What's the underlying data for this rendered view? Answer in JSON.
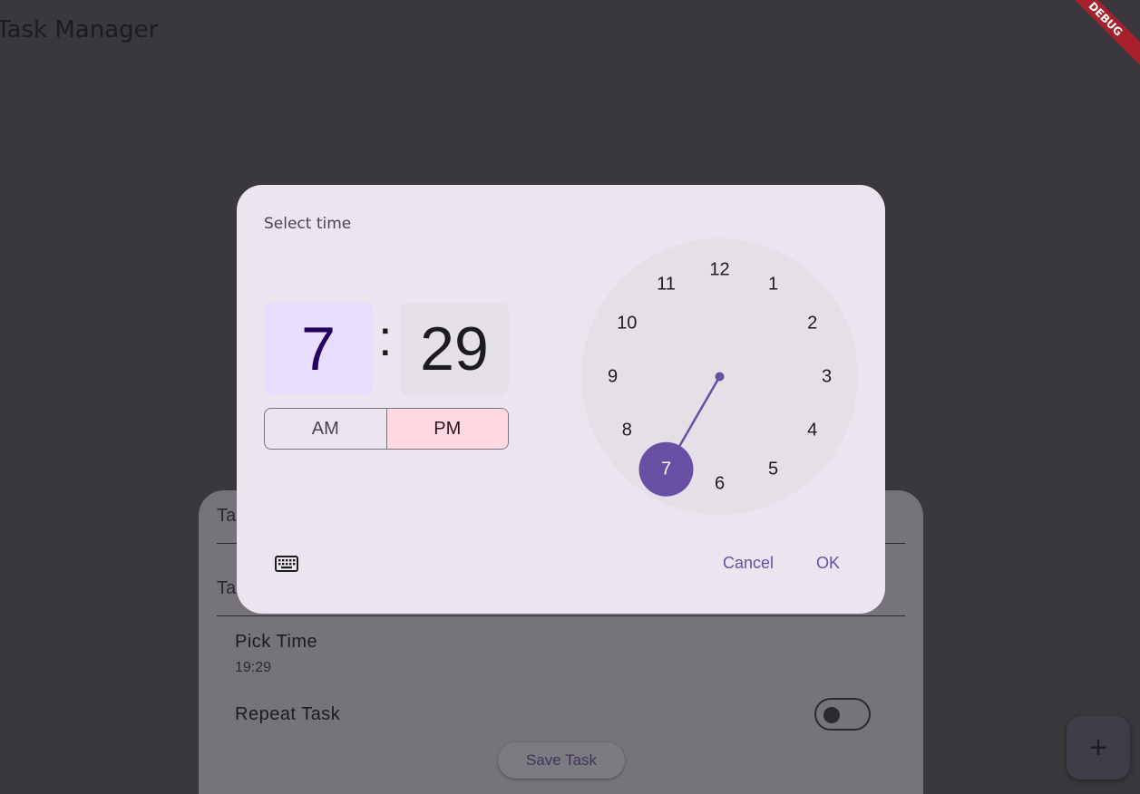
{
  "app": {
    "title": "Task Manager",
    "debug_banner": "DEBUG"
  },
  "sheet": {
    "field1_label": "Ta",
    "field2_label": "Ta",
    "pick_time_title": "Pick Time",
    "pick_time_value": "19:29",
    "repeat_title": "Repeat Task",
    "repeat_enabled": false,
    "save_label": "Save Task"
  },
  "fab": {
    "label": "+",
    "icon": "add-icon"
  },
  "dialog": {
    "title": "Select time",
    "hour": "7",
    "colon": ":",
    "minute": "29",
    "am_label": "AM",
    "pm_label": "PM",
    "period_selected": "PM",
    "cancel_label": "Cancel",
    "ok_label": "OK",
    "keyboard_icon": "keyboard-icon",
    "clock": {
      "numbers": [
        "12",
        "1",
        "2",
        "3",
        "4",
        "5",
        "6",
        "7",
        "8",
        "9",
        "10",
        "11"
      ],
      "selected": "7"
    }
  },
  "colors": {
    "accent": "#6750a4",
    "dialog_bg": "#ebe5f0",
    "hour_bg": "#e8ddfe",
    "pm_bg": "#ffd9e2",
    "scrim": "#3a383c"
  }
}
